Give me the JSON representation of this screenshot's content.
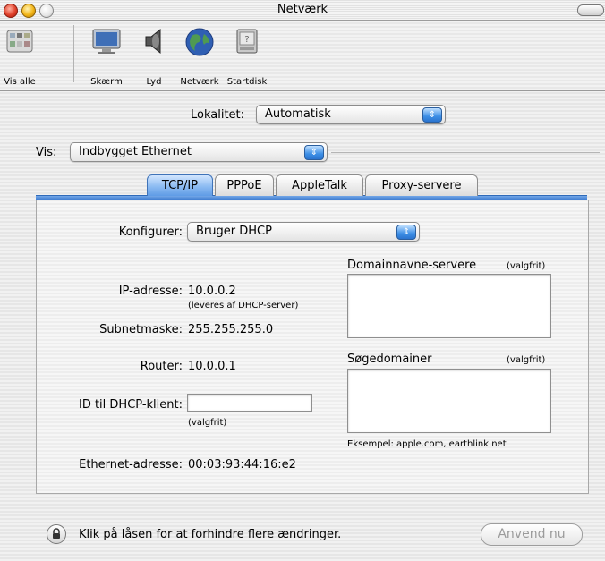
{
  "window": {
    "title": "Netværk"
  },
  "toolbar": {
    "items": [
      {
        "label": "Vis alle",
        "icon": "show-all-icon"
      },
      {
        "label": "Skærm",
        "icon": "display-icon"
      },
      {
        "label": "Lyd",
        "icon": "speaker-icon"
      },
      {
        "label": "Netværk",
        "icon": "globe-icon"
      },
      {
        "label": "Startdisk",
        "icon": "startup-disk-icon"
      }
    ]
  },
  "location": {
    "label": "Lokalitet:",
    "value": "Automatisk"
  },
  "show": {
    "label": "Vis:",
    "value": "Indbygget Ethernet"
  },
  "tabs": [
    {
      "label": "TCP/IP",
      "active": true
    },
    {
      "label": "PPPoE",
      "active": false
    },
    {
      "label": "AppleTalk",
      "active": false
    },
    {
      "label": "Proxy-servere",
      "active": false
    }
  ],
  "tcpip": {
    "configure_label": "Konfigurer:",
    "configure_value": "Bruger DHCP",
    "ip_label": "IP-adresse:",
    "ip_value": "10.0.0.2",
    "ip_note": "(leveres af DHCP-server)",
    "subnet_label": "Subnetmaske:",
    "subnet_value": "255.255.255.0",
    "router_label": "Router:",
    "router_value": "10.0.0.1",
    "dhcp_client_label": "ID til DHCP-klient:",
    "dhcp_client_value": "",
    "dhcp_client_note": "(valgfrit)",
    "ethernet_label": "Ethernet-adresse:",
    "ethernet_value": "00:03:93:44:16:e2",
    "dns_label": "Domainnavne-servere",
    "dns_note": "(valgfrit)",
    "search_label": "Søgedomainer",
    "search_note": "(valgfrit)",
    "example": "Eksempel: apple.com, earthlink.net"
  },
  "footer": {
    "lock_text": "Klik på låsen for at forhindre flere ændringer.",
    "apply_label": "Anvend nu"
  },
  "colors": {
    "accent": "#3f7dd0",
    "disabled_text": "#9b9b9b"
  }
}
